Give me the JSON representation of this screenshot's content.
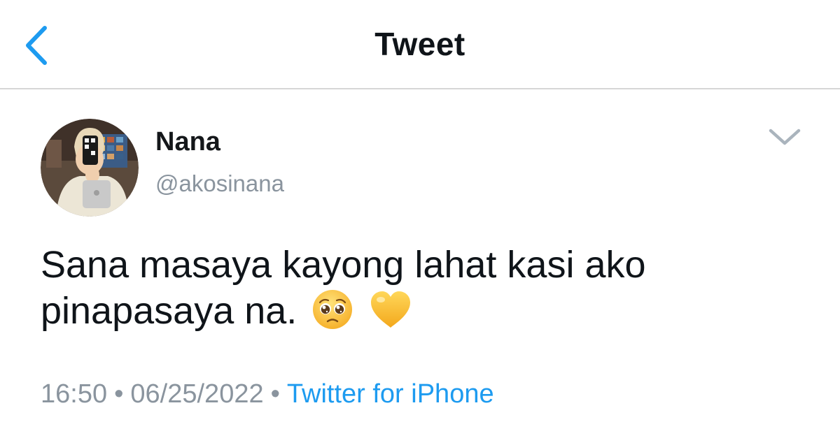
{
  "header": {
    "title": "Tweet",
    "back_icon": "chevron-left-icon"
  },
  "colors": {
    "accent": "#1d9bf0",
    "secondary_text": "#8a949e",
    "divider": "#d6d6d6"
  },
  "tweet": {
    "author": {
      "display_name": "Nana",
      "handle": "@akosinana",
      "avatar_icon": "avatar-photo"
    },
    "more_icon": "chevron-down-icon",
    "text_lines": [
      "Sana masaya kayong lahat kasi ako",
      "pinapasaya na."
    ],
    "emojis": [
      "pleading-face-emoji",
      "yellow-heart-emoji"
    ],
    "time": "16:50",
    "separator": "•",
    "date": "06/25/2022",
    "source": "Twitter for iPhone"
  }
}
